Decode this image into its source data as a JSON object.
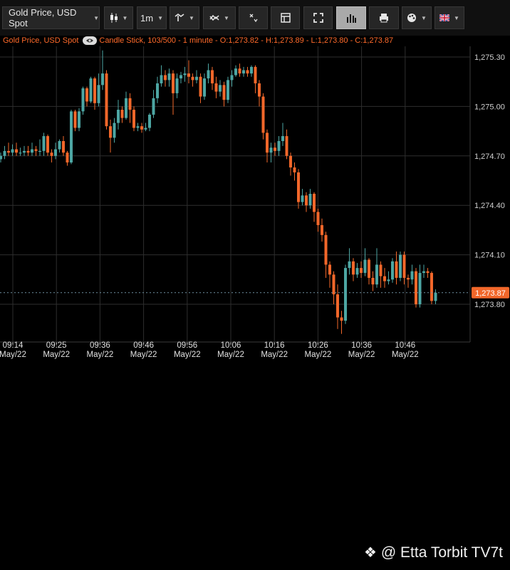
{
  "toolbar": {
    "instrument": "Gold Price, USD Spot",
    "interval": "1m"
  },
  "info_line": {
    "instrument": "Gold Price, USD Spot",
    "details": "Candle Stick, 103/500 - 1 minute - O:1,273.82 - H:1,273.89 - L:1,273.80 - C:1,273.87"
  },
  "watermark": {
    "text": "@ Etta Torbit TV7t"
  },
  "colors": {
    "up": "#4da6a3",
    "down": "#f2672a",
    "grid": "#2e2e2e",
    "last_price": "#f2672a"
  },
  "chart_data": {
    "type": "candlestick",
    "y_ticks": [
      "1,275.30",
      "1,275.00",
      "1,274.70",
      "1,274.40",
      "1,274.10",
      "1,273.80"
    ],
    "ylim": [
      1273.7,
      1275.4
    ],
    "x_ticks": [
      {
        "time": "09:14",
        "date": "May/22"
      },
      {
        "time": "09:25",
        "date": "May/22"
      },
      {
        "time": "09:36",
        "date": "May/22"
      },
      {
        "time": "09:46",
        "date": "May/22"
      },
      {
        "time": "09:56",
        "date": "May/22"
      },
      {
        "time": "10:06",
        "date": "May/22"
      },
      {
        "time": "10:16",
        "date": "May/22"
      },
      {
        "time": "10:26",
        "date": "May/22"
      },
      {
        "time": "10:36",
        "date": "May/22"
      },
      {
        "time": "10:46",
        "date": "May/22"
      }
    ],
    "last_price": {
      "value": 1273.87,
      "label": "1,273.87"
    },
    "candles": [
      [
        1274.68,
        1274.7,
        1274.72,
        1274.66
      ],
      [
        1274.7,
        1274.73,
        1274.76,
        1274.68
      ],
      [
        1274.73,
        1274.72,
        1274.78,
        1274.7
      ],
      [
        1274.72,
        1274.74,
        1274.77,
        1274.7
      ],
      [
        1274.74,
        1274.72,
        1274.78,
        1274.7
      ],
      [
        1274.72,
        1274.72,
        1274.75,
        1274.7
      ],
      [
        1274.72,
        1274.73,
        1274.76,
        1274.7
      ],
      [
        1274.73,
        1274.72,
        1274.76,
        1274.7
      ],
      [
        1274.72,
        1274.74,
        1274.78,
        1274.7
      ],
      [
        1274.74,
        1274.73,
        1274.76,
        1274.7
      ],
      [
        1274.73,
        1274.73,
        1274.8,
        1274.7
      ],
      [
        1274.73,
        1274.82,
        1274.84,
        1274.7
      ],
      [
        1274.82,
        1274.72,
        1274.83,
        1274.7
      ],
      [
        1274.72,
        1274.7,
        1274.74,
        1274.66
      ],
      [
        1274.7,
        1274.74,
        1274.78,
        1274.68
      ],
      [
        1274.74,
        1274.79,
        1274.8,
        1274.72
      ],
      [
        1274.79,
        1274.72,
        1274.82,
        1274.7
      ],
      [
        1274.72,
        1274.66,
        1274.73,
        1274.64
      ],
      [
        1274.66,
        1274.97,
        1274.98,
        1274.65
      ],
      [
        1274.97,
        1274.87,
        1274.98,
        1274.85
      ],
      [
        1274.87,
        1274.97,
        1274.99,
        1274.85
      ],
      [
        1274.97,
        1275.11,
        1275.12,
        1274.95
      ],
      [
        1275.11,
        1275.03,
        1275.12,
        1275.0
      ],
      [
        1275.03,
        1275.17,
        1275.18,
        1275.02
      ],
      [
        1275.17,
        1275.02,
        1275.18,
        1274.98
      ],
      [
        1275.02,
        1275.13,
        1275.2,
        1275.0
      ],
      [
        1275.13,
        1275.2,
        1275.34,
        1275.1
      ],
      [
        1275.2,
        1274.88,
        1275.22,
        1274.86
      ],
      [
        1274.88,
        1274.81,
        1274.92,
        1274.72
      ],
      [
        1274.81,
        1274.9,
        1274.93,
        1274.78
      ],
      [
        1274.9,
        1274.98,
        1275.04,
        1274.86
      ],
      [
        1274.98,
        1274.93,
        1275.0,
        1274.9
      ],
      [
        1274.93,
        1275.05,
        1275.09,
        1274.92
      ],
      [
        1275.05,
        1274.98,
        1275.08,
        1274.9
      ],
      [
        1274.98,
        1274.87,
        1275.0,
        1274.85
      ],
      [
        1274.87,
        1274.88,
        1274.9,
        1274.85
      ],
      [
        1274.88,
        1274.86,
        1274.9,
        1274.84
      ],
      [
        1274.86,
        1274.87,
        1274.9,
        1274.85
      ],
      [
        1274.87,
        1274.95,
        1274.96,
        1274.85
      ],
      [
        1274.95,
        1275.05,
        1275.1,
        1274.93
      ],
      [
        1275.05,
        1275.14,
        1275.18,
        1275.02
      ],
      [
        1275.14,
        1275.19,
        1275.25,
        1275.12
      ],
      [
        1275.19,
        1275.16,
        1275.22,
        1275.12
      ],
      [
        1275.16,
        1275.2,
        1275.23,
        1275.12
      ],
      [
        1275.2,
        1275.08,
        1275.22,
        1274.95
      ],
      [
        1275.08,
        1275.17,
        1275.2,
        1275.05
      ],
      [
        1275.17,
        1275.19,
        1275.21,
        1275.14
      ],
      [
        1275.19,
        1275.2,
        1275.24,
        1275.15
      ],
      [
        1275.2,
        1275.18,
        1275.28,
        1275.14
      ],
      [
        1275.18,
        1275.16,
        1275.2,
        1275.12
      ],
      [
        1275.16,
        1275.18,
        1275.22,
        1275.14
      ],
      [
        1275.18,
        1275.06,
        1275.2,
        1275.02
      ],
      [
        1275.06,
        1275.17,
        1275.2,
        1275.04
      ],
      [
        1275.17,
        1275.22,
        1275.26,
        1275.14
      ],
      [
        1275.22,
        1275.14,
        1275.24,
        1275.1
      ],
      [
        1275.14,
        1275.09,
        1275.18,
        1275.05
      ],
      [
        1275.09,
        1275.13,
        1275.16,
        1275.06
      ],
      [
        1275.13,
        1275.04,
        1275.15,
        1275.0
      ],
      [
        1275.04,
        1275.16,
        1275.18,
        1275.02
      ],
      [
        1275.16,
        1275.19,
        1275.22,
        1275.12
      ],
      [
        1275.19,
        1275.23,
        1275.25,
        1275.18
      ],
      [
        1275.23,
        1275.2,
        1275.26,
        1275.18
      ],
      [
        1275.2,
        1275.22,
        1275.24,
        1275.18
      ],
      [
        1275.22,
        1275.2,
        1275.24,
        1275.18
      ],
      [
        1275.2,
        1275.24,
        1275.25,
        1275.18
      ],
      [
        1275.24,
        1275.14,
        1275.25,
        1275.08
      ],
      [
        1275.14,
        1275.06,
        1275.16,
        1275.0
      ],
      [
        1275.06,
        1274.84,
        1275.08,
        1274.8
      ],
      [
        1274.84,
        1274.72,
        1274.86,
        1274.66
      ],
      [
        1274.72,
        1274.75,
        1274.78,
        1274.66
      ],
      [
        1274.75,
        1274.73,
        1274.78,
        1274.7
      ],
      [
        1274.73,
        1274.79,
        1274.82,
        1274.7
      ],
      [
        1274.79,
        1274.82,
        1274.9,
        1274.76
      ],
      [
        1274.82,
        1274.7,
        1274.86,
        1274.68
      ],
      [
        1274.7,
        1274.63,
        1274.72,
        1274.58
      ],
      [
        1274.63,
        1274.6,
        1274.66,
        1274.55
      ],
      [
        1274.6,
        1274.42,
        1274.62,
        1274.38
      ],
      [
        1274.42,
        1274.46,
        1274.5,
        1274.4
      ],
      [
        1274.46,
        1274.4,
        1274.48,
        1274.36
      ],
      [
        1274.4,
        1274.47,
        1274.5,
        1274.38
      ],
      [
        1274.47,
        1274.36,
        1274.48,
        1274.3
      ],
      [
        1274.36,
        1274.28,
        1274.38,
        1274.24
      ],
      [
        1274.28,
        1274.22,
        1274.32,
        1274.18
      ],
      [
        1274.22,
        1274.04,
        1274.24,
        1273.96
      ],
      [
        1274.04,
        1273.98,
        1274.06,
        1273.9
      ],
      [
        1273.98,
        1273.86,
        1274.0,
        1273.8
      ],
      [
        1273.86,
        1273.72,
        1273.92,
        1273.65
      ],
      [
        1273.72,
        1273.7,
        1273.76,
        1273.62
      ],
      [
        1273.7,
        1274.02,
        1274.04,
        1273.68
      ],
      [
        1274.02,
        1274.06,
        1274.14,
        1273.98
      ],
      [
        1274.06,
        1273.98,
        1274.08,
        1273.94
      ],
      [
        1273.98,
        1274.02,
        1274.05,
        1273.96
      ],
      [
        1274.02,
        1273.99,
        1274.06,
        1273.96
      ],
      [
        1273.99,
        1274.07,
        1274.14,
        1273.97
      ],
      [
        1274.07,
        1273.96,
        1274.08,
        1273.92
      ],
      [
        1273.96,
        1273.92,
        1274.0,
        1273.88
      ],
      [
        1273.92,
        1274.04,
        1274.14,
        1273.9
      ],
      [
        1274.04,
        1273.97,
        1274.06,
        1273.9
      ],
      [
        1273.97,
        1273.94,
        1274.02,
        1273.9
      ],
      [
        1273.94,
        1273.95,
        1274.0,
        1273.92
      ],
      [
        1273.95,
        1274.06,
        1274.08,
        1273.93
      ],
      [
        1274.06,
        1273.96,
        1274.12,
        1273.92
      ],
      [
        1273.96,
        1274.1,
        1274.12,
        1273.94
      ],
      [
        1274.1,
        1273.96,
        1274.12,
        1273.92
      ],
      [
        1273.96,
        1273.95,
        1273.98,
        1273.9
      ],
      [
        1273.95,
        1274.0,
        1274.04,
        1273.92
      ],
      [
        1274.0,
        1273.8,
        1274.02,
        1273.78
      ],
      [
        1273.8,
        1273.99,
        1274.04,
        1273.78
      ],
      [
        1273.99,
        1274.0,
        1274.04,
        1273.96
      ],
      [
        1274.0,
        1273.99,
        1274.02,
        1273.96
      ],
      [
        1273.99,
        1273.82,
        1274.0,
        1273.8
      ],
      [
        1273.82,
        1273.87,
        1273.89,
        1273.8
      ]
    ]
  }
}
